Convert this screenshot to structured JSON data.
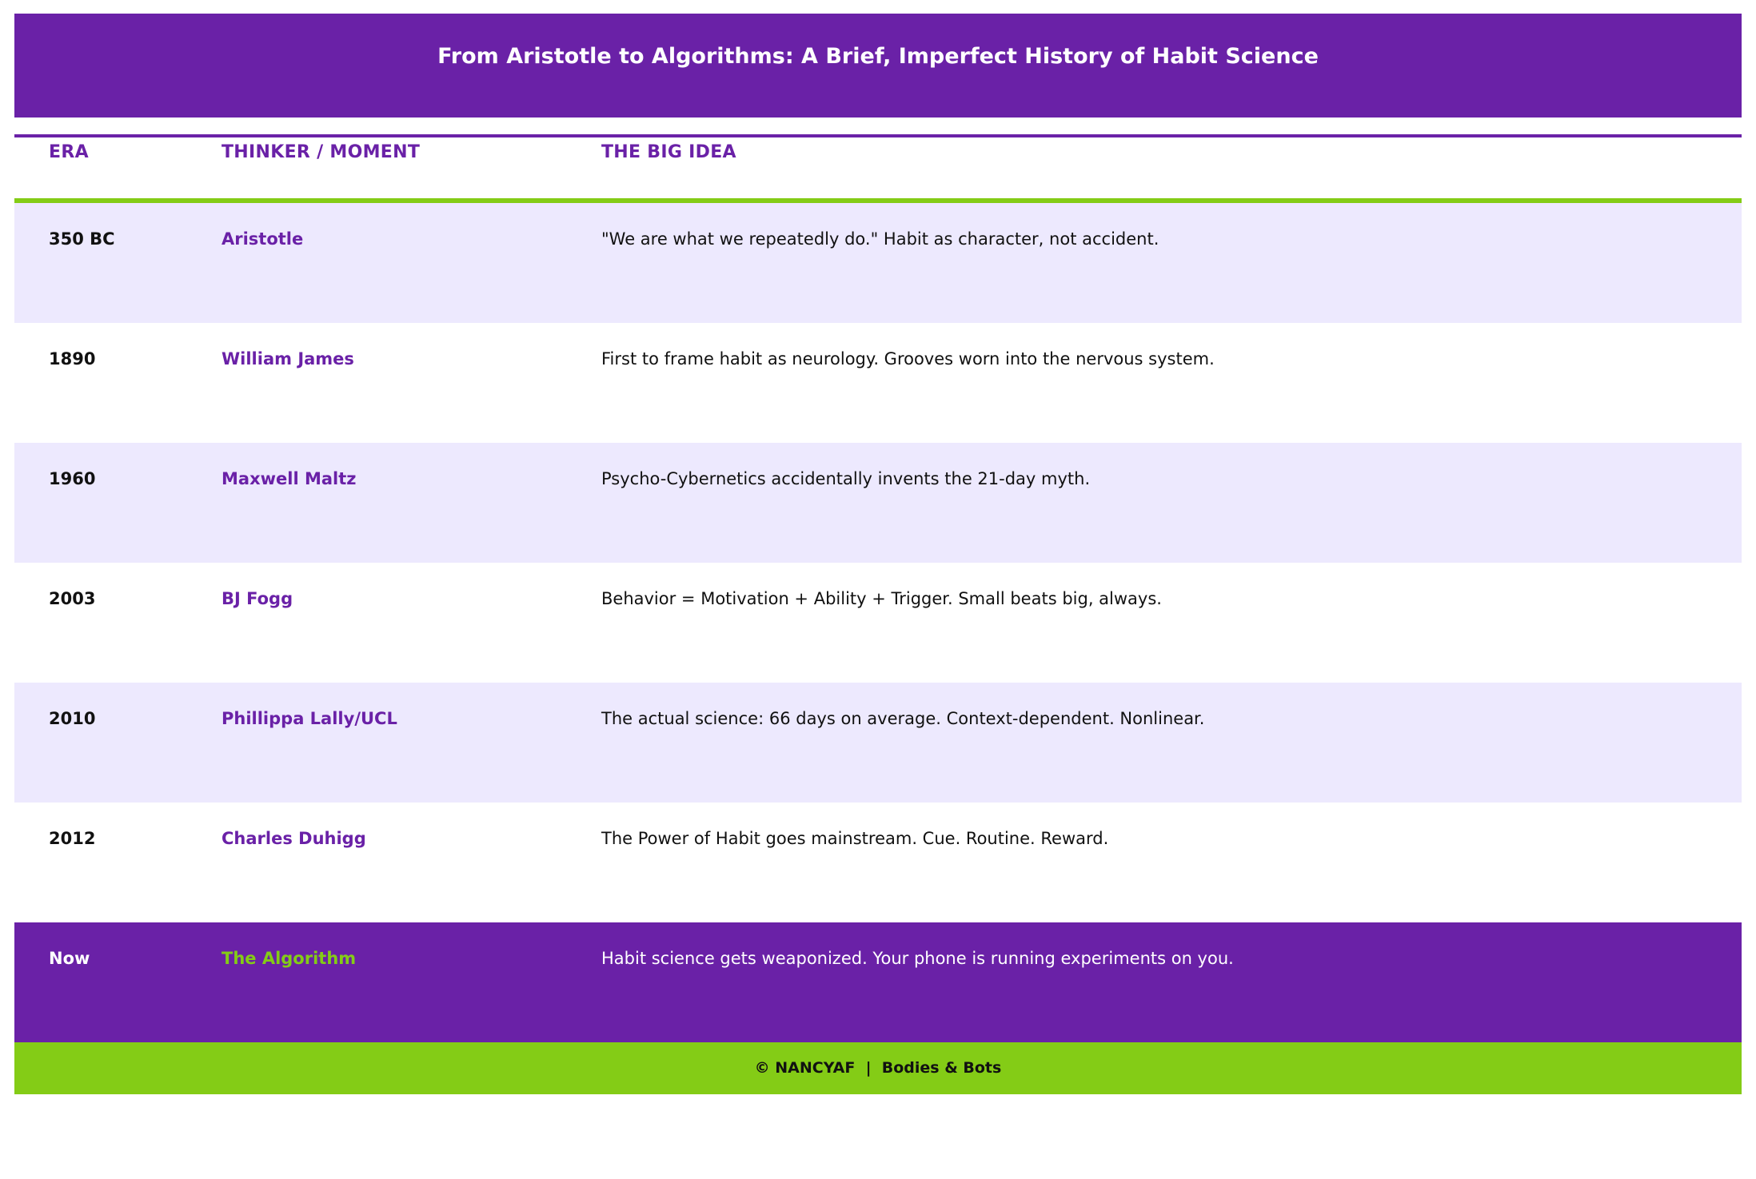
{
  "title": "From Aristotle to Algorithms: A Brief, Imperfect History of Habit Science",
  "columns": {
    "era": "ERA",
    "thinker": "THINKER / MOMENT",
    "idea": "THE BIG IDEA"
  },
  "rows": [
    {
      "era": "350 BC",
      "thinker": "Aristotle",
      "idea": "\"We are what we repeatedly do.\" Habit as character, not accident."
    },
    {
      "era": "1890",
      "thinker": "William James",
      "idea": "First to frame habit as neurology. Grooves worn into the nervous system."
    },
    {
      "era": "1960",
      "thinker": "Maxwell Maltz",
      "idea": "Psycho-Cybernetics accidentally invents the 21-day myth."
    },
    {
      "era": "2003",
      "thinker": "BJ Fogg",
      "idea": "Behavior = Motivation + Ability + Trigger. Small beats big, always."
    },
    {
      "era": "2010",
      "thinker": "Phillippa Lally/UCL",
      "idea": "The actual science: 66 days on average. Context-dependent. Nonlinear."
    },
    {
      "era": "2012",
      "thinker": "Charles Duhigg",
      "idea": "The Power of Habit goes mainstream. Cue. Routine. Reward."
    },
    {
      "era": "Now",
      "thinker": "The Algorithm",
      "idea": "Habit science gets weaponized. Your phone is running experiments on you."
    }
  ],
  "footer": "© NANCYAF  |  Bodies & Bots",
  "colors": {
    "primary": "#6a21a7",
    "accent": "#84cc16",
    "row_shade": "#ede9fe",
    "text": "#111111"
  }
}
